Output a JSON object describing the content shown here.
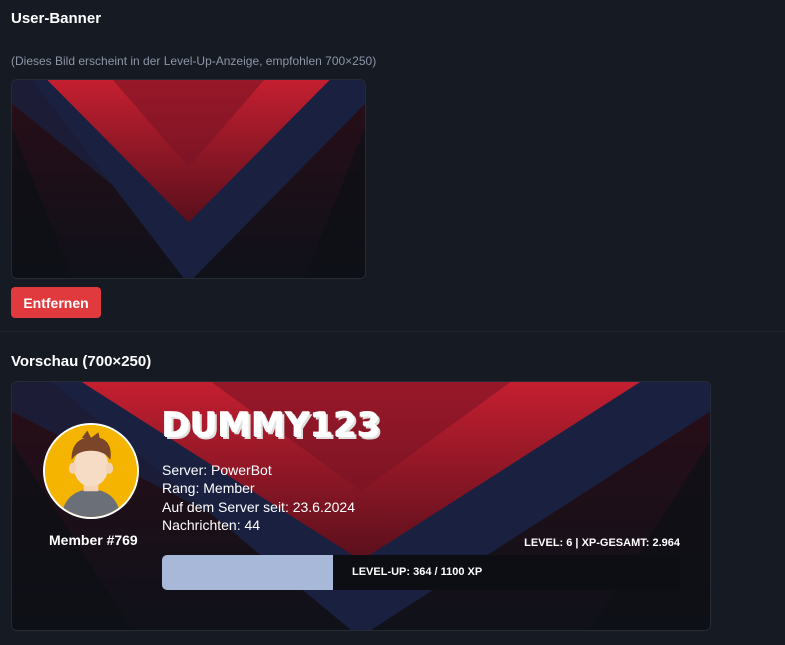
{
  "banner_section": {
    "title": "User-Banner",
    "hint": "(Dieses Bild erscheint in der Level-Up-Anzeige, empfohlen 700×250)",
    "remove_label": "Entfernen"
  },
  "preview_section": {
    "title": "Vorschau (700×250)"
  },
  "card": {
    "username": "DUMMY123",
    "member_label": "Member #769",
    "server": "Server: PowerBot",
    "rank": "Rang: Member",
    "joined": "Auf dem Server seit: 23.6.2024",
    "messages": "Nachrichten: 44",
    "level_summary": "LEVEL: 6 | XP-GESAMT: 2.964",
    "xp_text": "LEVEL-UP: 364 / 1100 XP",
    "xp_progress": 0.331
  },
  "colors": {
    "background": "#161a22",
    "remove_button": "#e0393e",
    "banner_red": "#c0202e",
    "banner_navy": "#1c2444",
    "xp_fill": "#a7b8d9"
  }
}
